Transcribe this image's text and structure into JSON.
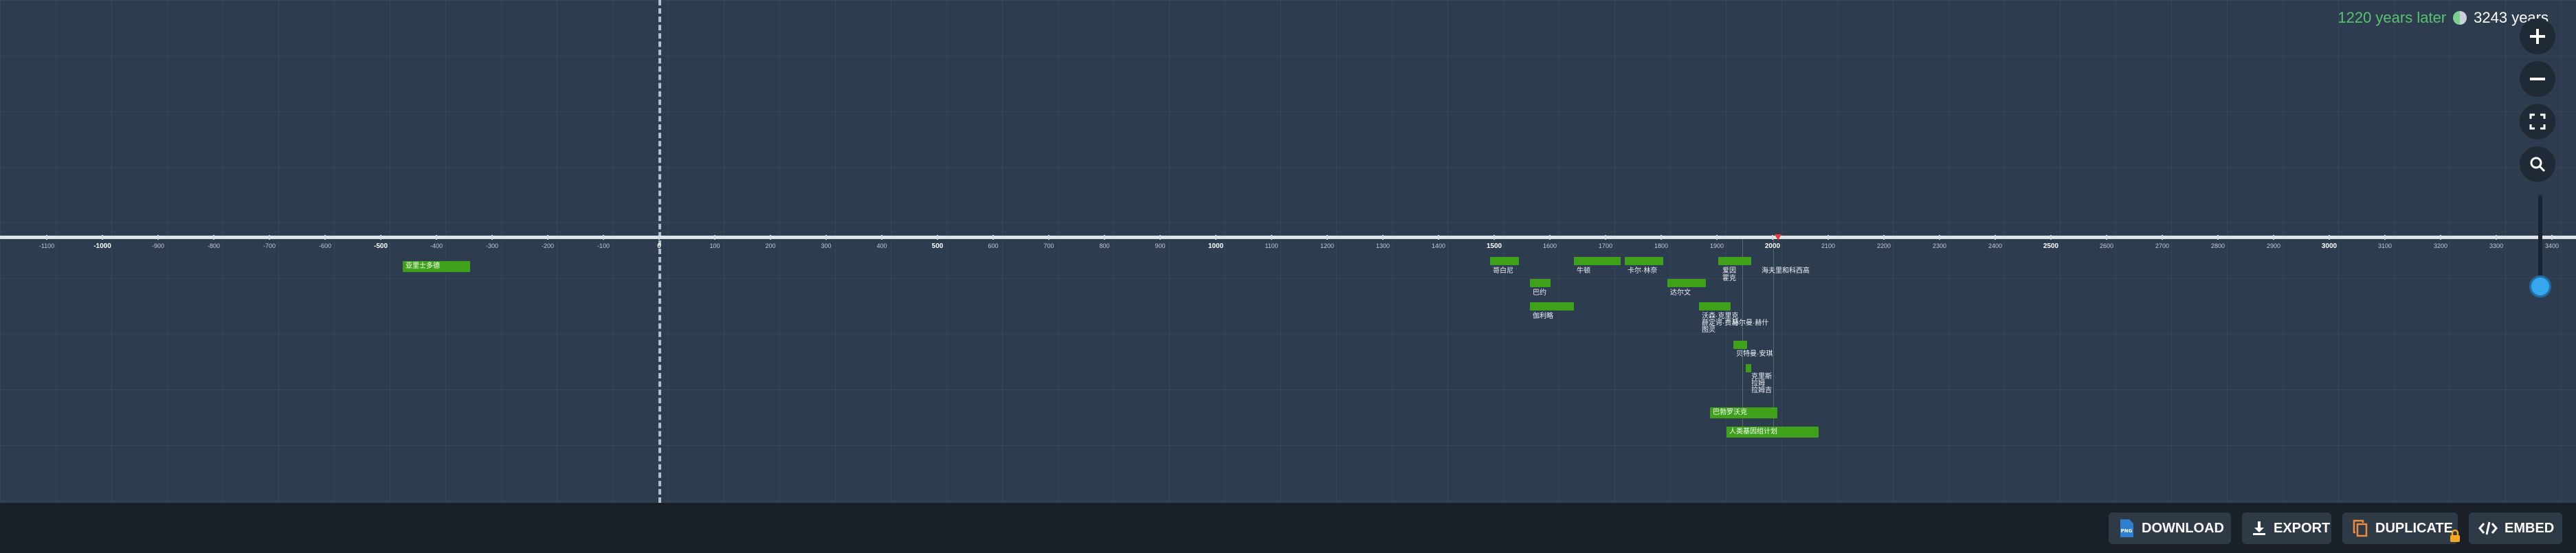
{
  "status": {
    "later": "1220 years later",
    "total": "3243 years"
  },
  "axis": {
    "ticks": [
      {
        "label": "-1100",
        "major": false
      },
      {
        "label": "-1000",
        "major": true
      },
      {
        "label": "-900",
        "major": false
      },
      {
        "label": "-800",
        "major": false
      },
      {
        "label": "-700",
        "major": false
      },
      {
        "label": "-600",
        "major": false
      },
      {
        "label": "-500",
        "major": true
      },
      {
        "label": "-400",
        "major": false
      },
      {
        "label": "-300",
        "major": false
      },
      {
        "label": "-200",
        "major": false
      },
      {
        "label": "-100",
        "major": false
      },
      {
        "label": "0",
        "major": true
      },
      {
        "label": "100",
        "major": false
      },
      {
        "label": "200",
        "major": false
      },
      {
        "label": "300",
        "major": false
      },
      {
        "label": "400",
        "major": false
      },
      {
        "label": "500",
        "major": true
      },
      {
        "label": "600",
        "major": false
      },
      {
        "label": "700",
        "major": false
      },
      {
        "label": "800",
        "major": false
      },
      {
        "label": "900",
        "major": false
      },
      {
        "label": "1000",
        "major": true
      },
      {
        "label": "1100",
        "major": false
      },
      {
        "label": "1200",
        "major": false
      },
      {
        "label": "1300",
        "major": false
      },
      {
        "label": "1400",
        "major": false
      },
      {
        "label": "1500",
        "major": true
      },
      {
        "label": "1600",
        "major": false
      },
      {
        "label": "1700",
        "major": false
      },
      {
        "label": "1800",
        "major": false
      },
      {
        "label": "1900",
        "major": false
      },
      {
        "label": "2000",
        "major": true
      },
      {
        "label": "2100",
        "major": false
      },
      {
        "label": "2200",
        "major": false
      },
      {
        "label": "2300",
        "major": false
      },
      {
        "label": "2400",
        "major": false
      },
      {
        "label": "2500",
        "major": true
      },
      {
        "label": "2600",
        "major": false
      },
      {
        "label": "2700",
        "major": false
      },
      {
        "label": "2800",
        "major": false
      },
      {
        "label": "2900",
        "major": false
      },
      {
        "label": "3000",
        "major": true
      },
      {
        "label": "3100",
        "major": false
      },
      {
        "label": "3200",
        "major": false
      },
      {
        "label": "3300",
        "major": false
      },
      {
        "label": "3400",
        "major": false
      }
    ]
  },
  "events": {
    "e1": "亚里士多德",
    "e2": "哥白尼",
    "e3": "巴约",
    "e4": "伽利略",
    "e5": "牛顿",
    "e6": "卡尔·林奈",
    "e7": "达尔文",
    "e8": "爱因",
    "e9": "霍克",
    "e10": "海夫里和科西高",
    "e11": "沃森·克里克",
    "e12": "薛定谔·费马",
    "e13": "赫尔曼·赫什",
    "e14": "图灵",
    "e15": "贝特曼·安琪",
    "e16": "克里斯",
    "e17": "拉姆",
    "e18": "拉姆吉",
    "e19": "巴勃罗沃克",
    "e20": "人类基因组计划"
  },
  "footer": {
    "download": "DOWNLOAD",
    "export": "EXPORT",
    "duplicate": "DUPLICATE",
    "embed": "EMBED"
  },
  "colors": {
    "event": "#3fa11a",
    "slider": "#36a7ee",
    "accent_status": "#58c26f"
  },
  "icons": [
    "plus-icon",
    "minus-icon",
    "fullscreen-icon",
    "search-icon",
    "png-file-icon",
    "download-icon",
    "copy-icon",
    "lock-icon",
    "code-icon"
  ]
}
